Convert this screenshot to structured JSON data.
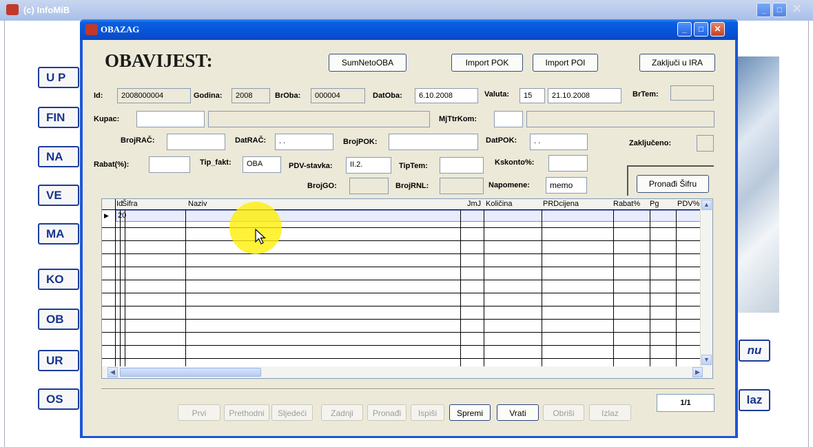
{
  "background_app": {
    "title": "(c) InfoMiB",
    "left_buttons": [
      "U P",
      "FIN",
      "NA",
      "VE",
      "MA",
      "KO",
      "OB",
      "UR",
      "OS"
    ],
    "right_buttons": [
      "nu",
      "laz"
    ]
  },
  "dialog": {
    "title": "OBAZAG",
    "heading": "OBAVIJEST:",
    "buttons": {
      "sum_neto": "SumNetoOBA",
      "import_pok": "Import POK",
      "import_poi": "Import POI",
      "zakljuci": "Zaključi u IRA",
      "pronadi_sifru": "Pronađi Šifru"
    },
    "fields": {
      "id": {
        "label": "Id:",
        "value": "2008000004"
      },
      "godina": {
        "label": "Godina:",
        "value": "2008"
      },
      "broba": {
        "label": "BrOba:",
        "value": "000004"
      },
      "datoba": {
        "label": "DatOba:",
        "value": "6.10.2008"
      },
      "valuta": {
        "label": "Valuta:",
        "value": "15"
      },
      "valuta_date": {
        "value": "21.10.2008"
      },
      "brtem": {
        "label": "BrTem:",
        "value": ""
      },
      "kupac": {
        "label": "Kupac:",
        "value": ""
      },
      "mjttrkom": {
        "label": "MjTtrKom:",
        "value": ""
      },
      "brojrac": {
        "label": "BrojRAČ:",
        "value": ""
      },
      "datrac": {
        "label": "DatRAČ:",
        "value": " . ."
      },
      "brojpok": {
        "label": "BrojPOK:",
        "value": ""
      },
      "datpok": {
        "label": "DatPOK:",
        "value": " . ."
      },
      "zakljuceno": {
        "label": "Zaključeno:",
        "value": ""
      },
      "rabat": {
        "label": "Rabat(%):",
        "value": ""
      },
      "tip_fakt": {
        "label": "Tip_fakt:",
        "value": "OBA"
      },
      "pdv_stavka": {
        "label": "PDV-stavka:",
        "value": "II.2."
      },
      "tiptem": {
        "label": "TipTem:",
        "value": ""
      },
      "kskonto": {
        "label": "Kskonto%:",
        "value": ""
      },
      "brojgo": {
        "label": "BrojGO:",
        "value": ""
      },
      "brojrnl": {
        "label": "BrojRNL:",
        "value": ""
      },
      "napomene": {
        "label": "Napomene:",
        "value": "memo"
      }
    },
    "grid": {
      "columns": [
        "Id",
        "Šifra",
        "Naziv",
        "JmJ",
        "Količina",
        "PRDcijena",
        "Rabat%",
        "Pg",
        "PDV%"
      ],
      "first_row_id": "20",
      "row_marker": "▶"
    },
    "nav_buttons": [
      "Prvi",
      "Prethodni",
      "Sljedeći",
      "Zadnji",
      "Pronađi",
      "Ispiši",
      "Spremi",
      "Vrati",
      "Obriši",
      "Izlaz"
    ],
    "nav_enabled": [
      false,
      false,
      false,
      false,
      false,
      false,
      true,
      true,
      false,
      false
    ],
    "record_counter": "1/1"
  }
}
